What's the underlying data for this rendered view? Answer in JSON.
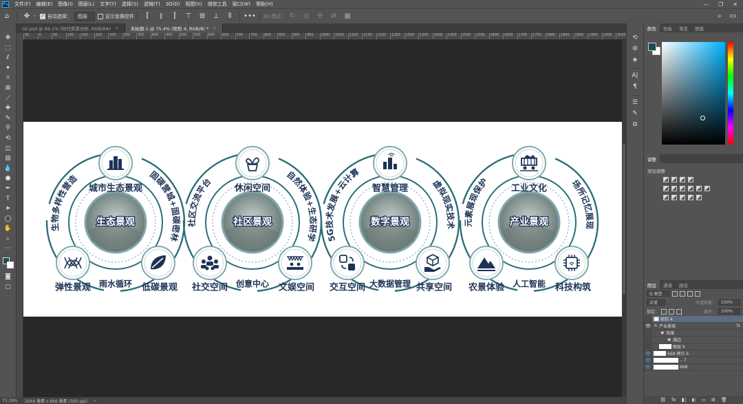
{
  "app": {
    "logo": "Ps",
    "menu": [
      "文件(F)",
      "编辑(E)",
      "图像(I)",
      "图层(L)",
      "文字(Y)",
      "选择(S)",
      "滤镜(T)",
      "3D(D)",
      "视图(V)",
      "增效工具",
      "窗口(W)",
      "帮助(H)"
    ],
    "window_controls": [
      "—",
      "❐",
      "✕"
    ]
  },
  "options_bar": {
    "auto_select_label": "自动选择：",
    "auto_select_value": "图层",
    "show_transform_label": "显示变换控件",
    "mode_label": "3D 模式：",
    "more": "•••"
  },
  "tabs": [
    {
      "label": "02.psd @ 69.1% (时代背景分析, RGB/8#)",
      "close": "×",
      "active": false
    },
    {
      "label": "未标题-1 @ 75.4% (矩形 4, RGB/8) *",
      "close": "×",
      "active": true
    }
  ],
  "ruler_ticks": [
    "50",
    "0",
    "50",
    "100",
    "150",
    "200",
    "250",
    "300",
    "350",
    "400",
    "450",
    "500",
    "550",
    "600",
    "650",
    "700",
    "750",
    "800",
    "850",
    "900",
    "950",
    "1000",
    "1050",
    "1100",
    "1150",
    "1200",
    "1250",
    "1300",
    "1350",
    "1400",
    "1450",
    "1500",
    "1550",
    "1600",
    "1650",
    "1700",
    "1750",
    "1800",
    "1850",
    "1900",
    "1950",
    "2000",
    "2050"
  ],
  "status": {
    "zoom": "75.39%",
    "doc_size": "2044 像素 x 666 像素 (300 ppi)"
  },
  "panels": {
    "color_tabs": [
      "颜色",
      "色板",
      "渐变",
      "图案"
    ],
    "adjust_tabs": [
      "调整"
    ],
    "adjust_subtitle": "添加调整",
    "layers_tabs": [
      "图层",
      "通道",
      "路径"
    ],
    "layers_filter": "Q 类型",
    "blend_mode": "正常",
    "opacity_label": "不透明度：",
    "opacity_value": "100%",
    "lock_label": "锁定：",
    "fill_label": "填充：",
    "fill_value": "100%",
    "layers": [
      {
        "name": "矩形 4",
        "selected": true,
        "fx": false
      },
      {
        "name": "产业景观",
        "selected": false,
        "fx": true
      },
      {
        "name": "效果",
        "selected": false,
        "fx": false
      },
      {
        "name": "描边",
        "selected": false,
        "fx": false
      },
      {
        "name": "图层 9",
        "selected": false,
        "fx": false
      },
      {
        "name": "668 拷贝 6",
        "selected": false,
        "fx": false
      },
      {
        "name": "...7",
        "selected": false,
        "fx": false
      },
      {
        "name": "668",
        "selected": false,
        "fx": false
      }
    ],
    "layer_fx_label": "fx"
  },
  "infographic": {
    "colors": {
      "navy": "#1c3356",
      "teal": "#2b6e79",
      "ring": "#7fa8ae"
    },
    "clusters": [
      {
        "center": "生态景观",
        "top_label": "城市生态景观",
        "left_arc": "生物多样性营造",
        "right_arc": "固碳营城+固碳密林",
        "bottom_left": "弹性景观",
        "bottom_mid": "雨水循环",
        "bottom_right": "低碳景观",
        "icons": [
          "city-buildings-icon",
          "dna-wave-icon",
          "leaf-icon"
        ]
      },
      {
        "center": "社区景观",
        "top_label": "休闲空间",
        "left_arc": "社区交流平台",
        "right_arc": "自然体验+生态研学",
        "bottom_left": "社交空间",
        "bottom_mid": "创意中心",
        "bottom_right": "文娱空间",
        "icons": [
          "potted-plant-icon",
          "people-group-icon",
          "stage-icon"
        ]
      },
      {
        "center": "数字景观",
        "top_label": "智慧管理",
        "left_arc": "5G技术发展+云计算",
        "right_arc": "虚拟现实技术",
        "bottom_left": "交互空间",
        "bottom_mid": "大数据管理",
        "bottom_right": "共享空间",
        "icons": [
          "smart-city-icon",
          "exchange-icon",
          "box-hand-icon"
        ]
      },
      {
        "center": "产业景观",
        "top_label": "工业文化",
        "left_arc": "元素展现保护",
        "right_arc": "场所记忆展现",
        "bottom_left": "农景体验",
        "bottom_mid": "人工智能",
        "bottom_right": "科技构筑",
        "icons": [
          "mine-cart-icon",
          "mountain-icon",
          "chip-icon"
        ]
      }
    ]
  }
}
